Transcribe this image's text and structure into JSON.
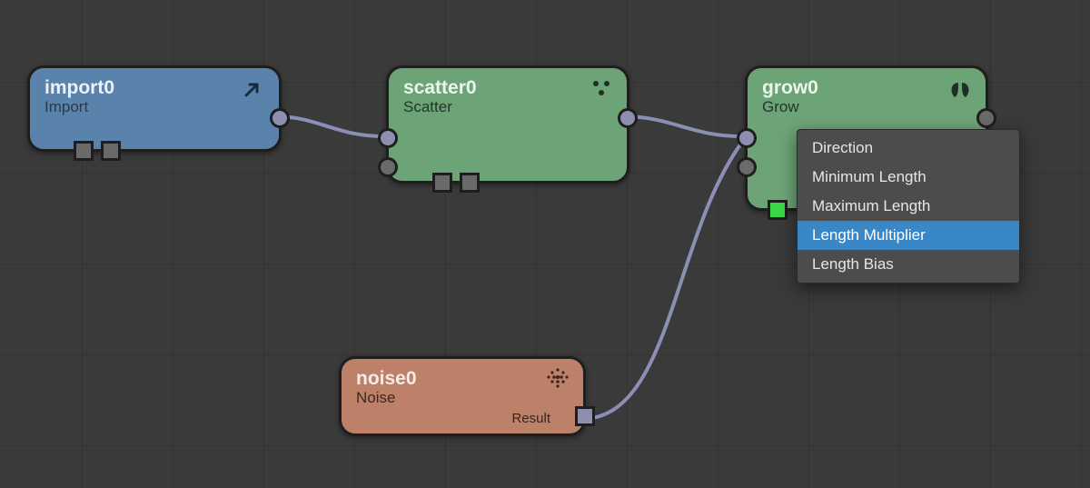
{
  "nodes": {
    "import0": {
      "title": "import0",
      "subtitle": "Import",
      "icon": "import-arrow-icon"
    },
    "scatter0": {
      "title": "scatter0",
      "subtitle": "Scatter",
      "icon": "scatter-dots-icon"
    },
    "grow0": {
      "title": "grow0",
      "subtitle": "Grow",
      "icon": "leaf-icon"
    },
    "noise0": {
      "title": "noise0",
      "subtitle": "Noise",
      "result_label": "Result",
      "icon": "noise-dots-icon"
    }
  },
  "context_menu": {
    "items": [
      {
        "label": "Direction",
        "selected": false
      },
      {
        "label": "Minimum Length",
        "selected": false
      },
      {
        "label": "Maximum Length",
        "selected": false
      },
      {
        "label": "Length Multiplier",
        "selected": true
      },
      {
        "label": "Length Bias",
        "selected": false
      }
    ]
  },
  "colors": {
    "wire": "#8b8fb6",
    "node_blue": "#5a83ab",
    "node_green": "#6da477",
    "node_brown": "#bd816a",
    "menu_highlight": "#3a87c8"
  }
}
